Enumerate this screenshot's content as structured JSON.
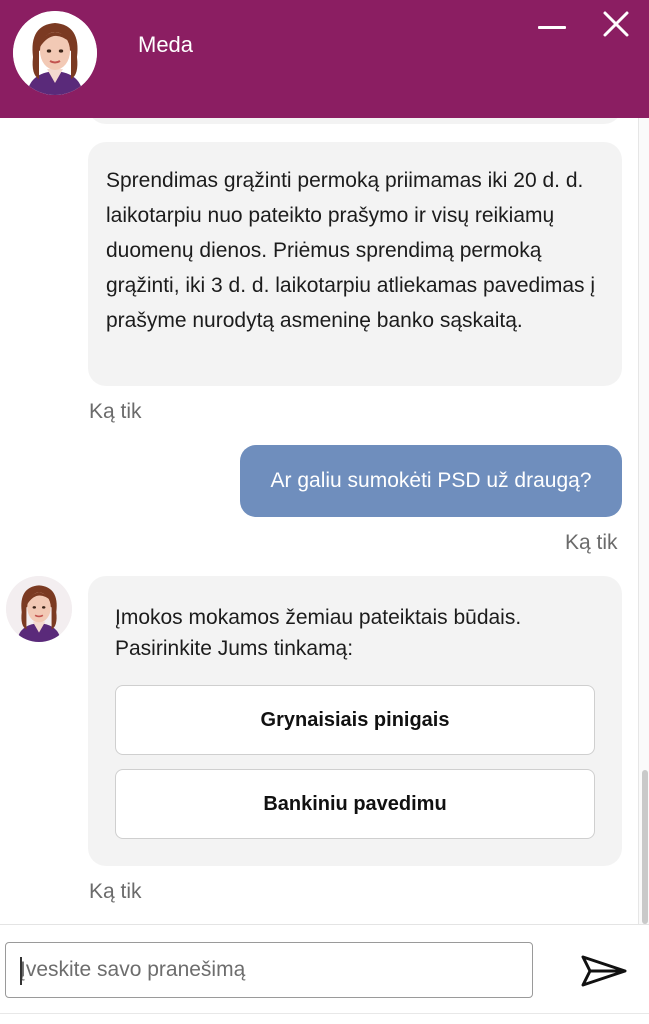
{
  "header": {
    "agent_name": "Meda",
    "background_color": "#8b1e62",
    "minimize_icon": "minimize-icon",
    "close_icon": "close-icon"
  },
  "messages": [
    {
      "from": "bot",
      "text": "Sprendimas grąžinti permoką priimamas iki 20 d. d. laikotarpiu nuo pateikto prašymo ir visų reikiamų duomenų dienos. Priėmus sprendimą permoką grąžinti, iki 3 d. d. laikotarpiu atliekamas pavedimas į prašyme nurodytą asmeninę banko sąskaitą.",
      "timestamp": "Ką tik"
    },
    {
      "from": "user",
      "text": "Ar galiu sumokėti PSD už draugą?",
      "timestamp": "Ką tik",
      "bubble_color": "#6f8ebd"
    },
    {
      "from": "bot",
      "text": "Įmokos mokamos žemiau pateiktais būdais. Pasirinkite Jums tinkamą:",
      "options": [
        "Grynaisiais pinigais",
        "Bankiniu pavedimu"
      ],
      "timestamp": "Ką tik"
    }
  ],
  "input": {
    "placeholder": "Įveskite savo pranešimą",
    "value": ""
  },
  "send_icon": "send-icon"
}
